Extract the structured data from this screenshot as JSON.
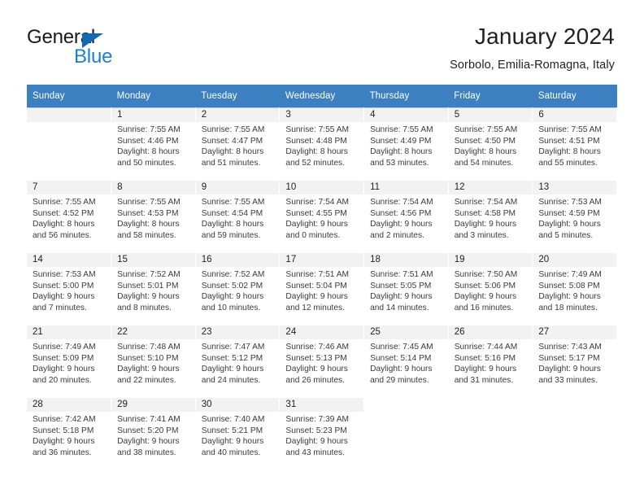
{
  "brand": {
    "name_top": "General",
    "name_bottom": "Blue",
    "accent_color": "#1c7fd6",
    "triangle_color": "#1268b3"
  },
  "header": {
    "title": "January 2024",
    "subtitle": "Sorbolo, Emilia-Romagna, Italy"
  },
  "calendar": {
    "header_bg": "#3d80c2",
    "daynum_bg": "#f2f2f2",
    "weekday_headers": [
      "Sunday",
      "Monday",
      "Tuesday",
      "Wednesday",
      "Thursday",
      "Friday",
      "Saturday"
    ],
    "weeks": [
      [
        {
          "day": "",
          "lines": []
        },
        {
          "day": "1",
          "lines": [
            "Sunrise: 7:55 AM",
            "Sunset: 4:46 PM",
            "Daylight: 8 hours",
            "and 50 minutes."
          ]
        },
        {
          "day": "2",
          "lines": [
            "Sunrise: 7:55 AM",
            "Sunset: 4:47 PM",
            "Daylight: 8 hours",
            "and 51 minutes."
          ]
        },
        {
          "day": "3",
          "lines": [
            "Sunrise: 7:55 AM",
            "Sunset: 4:48 PM",
            "Daylight: 8 hours",
            "and 52 minutes."
          ]
        },
        {
          "day": "4",
          "lines": [
            "Sunrise: 7:55 AM",
            "Sunset: 4:49 PM",
            "Daylight: 8 hours",
            "and 53 minutes."
          ]
        },
        {
          "day": "5",
          "lines": [
            "Sunrise: 7:55 AM",
            "Sunset: 4:50 PM",
            "Daylight: 8 hours",
            "and 54 minutes."
          ]
        },
        {
          "day": "6",
          "lines": [
            "Sunrise: 7:55 AM",
            "Sunset: 4:51 PM",
            "Daylight: 8 hours",
            "and 55 minutes."
          ]
        }
      ],
      [
        {
          "day": "7",
          "lines": [
            "Sunrise: 7:55 AM",
            "Sunset: 4:52 PM",
            "Daylight: 8 hours",
            "and 56 minutes."
          ]
        },
        {
          "day": "8",
          "lines": [
            "Sunrise: 7:55 AM",
            "Sunset: 4:53 PM",
            "Daylight: 8 hours",
            "and 58 minutes."
          ]
        },
        {
          "day": "9",
          "lines": [
            "Sunrise: 7:55 AM",
            "Sunset: 4:54 PM",
            "Daylight: 8 hours",
            "and 59 minutes."
          ]
        },
        {
          "day": "10",
          "lines": [
            "Sunrise: 7:54 AM",
            "Sunset: 4:55 PM",
            "Daylight: 9 hours",
            "and 0 minutes."
          ]
        },
        {
          "day": "11",
          "lines": [
            "Sunrise: 7:54 AM",
            "Sunset: 4:56 PM",
            "Daylight: 9 hours",
            "and 2 minutes."
          ]
        },
        {
          "day": "12",
          "lines": [
            "Sunrise: 7:54 AM",
            "Sunset: 4:58 PM",
            "Daylight: 9 hours",
            "and 3 minutes."
          ]
        },
        {
          "day": "13",
          "lines": [
            "Sunrise: 7:53 AM",
            "Sunset: 4:59 PM",
            "Daylight: 9 hours",
            "and 5 minutes."
          ]
        }
      ],
      [
        {
          "day": "14",
          "lines": [
            "Sunrise: 7:53 AM",
            "Sunset: 5:00 PM",
            "Daylight: 9 hours",
            "and 7 minutes."
          ]
        },
        {
          "day": "15",
          "lines": [
            "Sunrise: 7:52 AM",
            "Sunset: 5:01 PM",
            "Daylight: 9 hours",
            "and 8 minutes."
          ]
        },
        {
          "day": "16",
          "lines": [
            "Sunrise: 7:52 AM",
            "Sunset: 5:02 PM",
            "Daylight: 9 hours",
            "and 10 minutes."
          ]
        },
        {
          "day": "17",
          "lines": [
            "Sunrise: 7:51 AM",
            "Sunset: 5:04 PM",
            "Daylight: 9 hours",
            "and 12 minutes."
          ]
        },
        {
          "day": "18",
          "lines": [
            "Sunrise: 7:51 AM",
            "Sunset: 5:05 PM",
            "Daylight: 9 hours",
            "and 14 minutes."
          ]
        },
        {
          "day": "19",
          "lines": [
            "Sunrise: 7:50 AM",
            "Sunset: 5:06 PM",
            "Daylight: 9 hours",
            "and 16 minutes."
          ]
        },
        {
          "day": "20",
          "lines": [
            "Sunrise: 7:49 AM",
            "Sunset: 5:08 PM",
            "Daylight: 9 hours",
            "and 18 minutes."
          ]
        }
      ],
      [
        {
          "day": "21",
          "lines": [
            "Sunrise: 7:49 AM",
            "Sunset: 5:09 PM",
            "Daylight: 9 hours",
            "and 20 minutes."
          ]
        },
        {
          "day": "22",
          "lines": [
            "Sunrise: 7:48 AM",
            "Sunset: 5:10 PM",
            "Daylight: 9 hours",
            "and 22 minutes."
          ]
        },
        {
          "day": "23",
          "lines": [
            "Sunrise: 7:47 AM",
            "Sunset: 5:12 PM",
            "Daylight: 9 hours",
            "and 24 minutes."
          ]
        },
        {
          "day": "24",
          "lines": [
            "Sunrise: 7:46 AM",
            "Sunset: 5:13 PM",
            "Daylight: 9 hours",
            "and 26 minutes."
          ]
        },
        {
          "day": "25",
          "lines": [
            "Sunrise: 7:45 AM",
            "Sunset: 5:14 PM",
            "Daylight: 9 hours",
            "and 29 minutes."
          ]
        },
        {
          "day": "26",
          "lines": [
            "Sunrise: 7:44 AM",
            "Sunset: 5:16 PM",
            "Daylight: 9 hours",
            "and 31 minutes."
          ]
        },
        {
          "day": "27",
          "lines": [
            "Sunrise: 7:43 AM",
            "Sunset: 5:17 PM",
            "Daylight: 9 hours",
            "and 33 minutes."
          ]
        }
      ],
      [
        {
          "day": "28",
          "lines": [
            "Sunrise: 7:42 AM",
            "Sunset: 5:18 PM",
            "Daylight: 9 hours",
            "and 36 minutes."
          ]
        },
        {
          "day": "29",
          "lines": [
            "Sunrise: 7:41 AM",
            "Sunset: 5:20 PM",
            "Daylight: 9 hours",
            "and 38 minutes."
          ]
        },
        {
          "day": "30",
          "lines": [
            "Sunrise: 7:40 AM",
            "Sunset: 5:21 PM",
            "Daylight: 9 hours",
            "and 40 minutes."
          ]
        },
        {
          "day": "31",
          "lines": [
            "Sunrise: 7:39 AM",
            "Sunset: 5:23 PM",
            "Daylight: 9 hours",
            "and 43 minutes."
          ]
        },
        {
          "day": "",
          "lines": [],
          "blank": true
        },
        {
          "day": "",
          "lines": [],
          "blank": true
        },
        {
          "day": "",
          "lines": [],
          "blank": true
        }
      ]
    ]
  }
}
